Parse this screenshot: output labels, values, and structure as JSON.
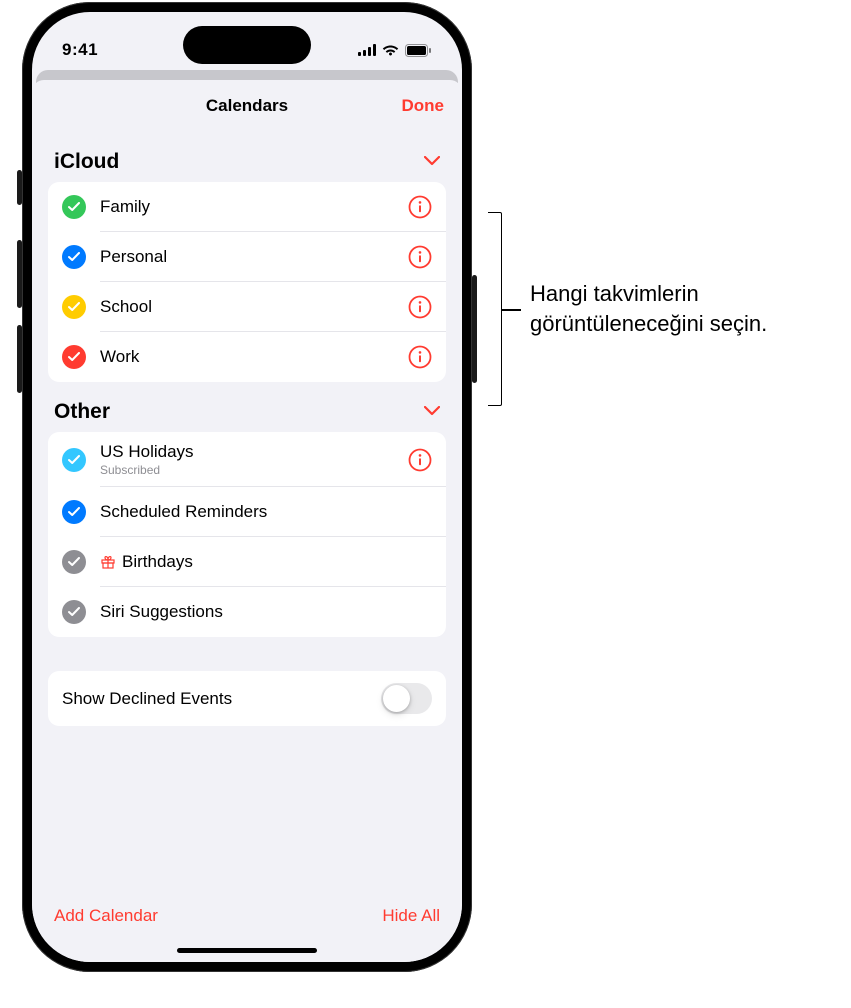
{
  "status": {
    "time": "9:41"
  },
  "nav": {
    "title": "Calendars",
    "done": "Done"
  },
  "sections": [
    {
      "title": "iCloud",
      "items": [
        {
          "label": "Family",
          "color": "#34c759",
          "hasInfo": true
        },
        {
          "label": "Personal",
          "color": "#007aff",
          "hasInfo": true
        },
        {
          "label": "School",
          "color": "#ffcc00",
          "hasInfo": true
        },
        {
          "label": "Work",
          "color": "#ff3b30",
          "hasInfo": true
        }
      ]
    },
    {
      "title": "Other",
      "items": [
        {
          "label": "US Holidays",
          "sublabel": "Subscribed",
          "color": "#33c7ff",
          "hasInfo": true
        },
        {
          "label": "Scheduled Reminders",
          "color": "#007aff",
          "hasInfo": false
        },
        {
          "label": "Birthdays",
          "color": "#8e8e93",
          "hasInfo": false,
          "prefixIcon": "gift"
        },
        {
          "label": "Siri Suggestions",
          "color": "#8e8e93",
          "hasInfo": false
        }
      ]
    }
  ],
  "declined": {
    "label": "Show Declined Events",
    "on": false
  },
  "bottom": {
    "add": "Add Calendar",
    "hide": "Hide All"
  },
  "callout": {
    "line1": "Hangi takvimlerin",
    "line2": "görüntüleneceğini seçin."
  }
}
